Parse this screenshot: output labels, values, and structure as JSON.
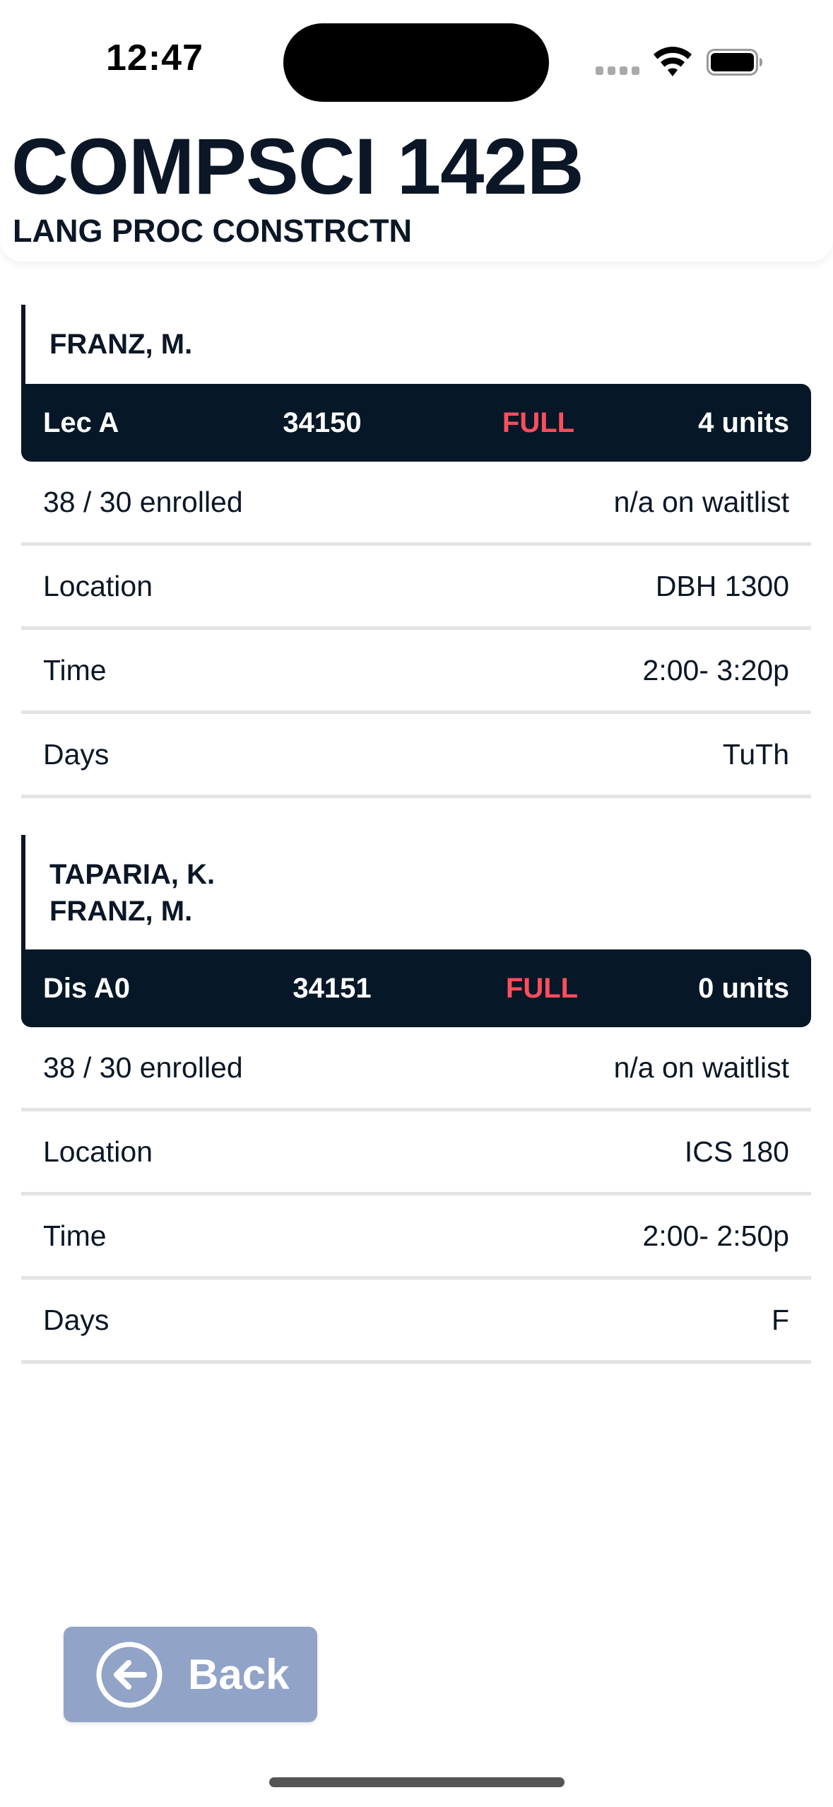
{
  "status_bar": {
    "time": "12:47"
  },
  "header": {
    "course_code": "COMPSCI 142B",
    "course_title": "LANG PROC CONSTRCTN"
  },
  "sections": [
    {
      "instructors": [
        "FRANZ, M."
      ],
      "type": "Lec A",
      "code": "34150",
      "status": "FULL",
      "units": "4 units",
      "enrolled": "38 / 30 enrolled",
      "waitlist": "n/a on waitlist",
      "location_label": "Location",
      "location": "DBH 1300",
      "time_label": "Time",
      "time": "2:00- 3:20p",
      "days_label": "Days",
      "days": "TuTh"
    },
    {
      "instructors": [
        "TAPARIA, K.",
        "FRANZ, M."
      ],
      "type": "Dis A0",
      "code": "34151",
      "status": "FULL",
      "units": "0 units",
      "enrolled": "38 / 30 enrolled",
      "waitlist": "n/a on waitlist",
      "location_label": "Location",
      "location": "ICS 180",
      "time_label": "Time",
      "time": "2:00- 2:50p",
      "days_label": "Days",
      "days": "F"
    }
  ],
  "back_button": {
    "label": "Back",
    "icon": "arrow-left-circle-icon"
  },
  "colors": {
    "navy": "#061827",
    "full_status": "#ff4e5e",
    "back_button_bg": "#91a3c6",
    "divider": "#e3e3e3"
  }
}
